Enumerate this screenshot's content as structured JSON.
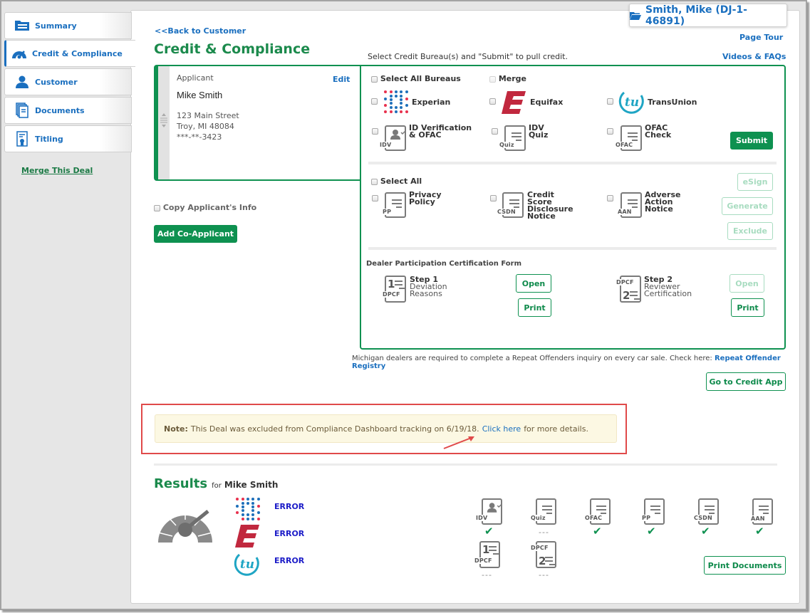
{
  "sidebar": {
    "items": [
      {
        "label": "Summary",
        "icon": "folder-list-icon",
        "active": false
      },
      {
        "label": "Credit & Compliance",
        "icon": "gauge-icon",
        "active": true
      },
      {
        "label": "Customer",
        "icon": "person-icon",
        "active": false
      },
      {
        "label": "Documents",
        "icon": "documents-icon",
        "active": false
      },
      {
        "label": "Titling",
        "icon": "certificate-icon",
        "active": false
      }
    ],
    "merge_link": "Merge This Deal"
  },
  "header": {
    "deal_badge": "Smith, Mike (DJ-1-46891)",
    "back_link": "<<Back to Customer",
    "title": "Credit & Compliance",
    "page_tour": "Page Tour",
    "videos_faqs": "Videos & FAQs",
    "instruction": "Select Credit Bureau(s) and \"Submit\" to pull credit."
  },
  "applicant": {
    "heading": "Applicant",
    "edit_label": "Edit",
    "name": "Mike Smith",
    "address1": "123 Main Street",
    "address2": "Troy, MI 48084",
    "ssn": "***-**-3423",
    "copy_label": "Copy Applicant's Info",
    "add_co_applicant": "Add Co-Applicant"
  },
  "bureaus": {
    "select_all": "Select All Bureaus",
    "merge": "Merge",
    "items": [
      {
        "label": "Experian",
        "icon": "experian-logo-icon"
      },
      {
        "label": "Equifax",
        "icon": "equifax-logo-icon"
      },
      {
        "label": "TransUnion",
        "icon": "transunion-logo-icon"
      }
    ],
    "checks": [
      {
        "line1": "ID Verification",
        "line2": "& OFAC",
        "tag": "IDV"
      },
      {
        "line1": "IDV",
        "line2": "Quiz",
        "tag": "Quiz"
      },
      {
        "line1": "OFAC",
        "line2": "Check",
        "tag": "OFAC"
      }
    ],
    "submit": "Submit"
  },
  "disclosures": {
    "select_all": "Select All",
    "items": [
      {
        "lines": [
          "Privacy",
          "Policy"
        ],
        "tag": "PP"
      },
      {
        "lines": [
          "Credit",
          "Score",
          "Disclosure",
          "Notice"
        ],
        "tag": "CSDN"
      },
      {
        "lines": [
          "Adverse",
          "Action",
          "Notice"
        ],
        "tag": "AAN"
      }
    ],
    "esign": "eSign",
    "generate": "Generate",
    "exclude": "Exclude"
  },
  "dpcf": {
    "heading": "Dealer Participation Certification Form",
    "step1": {
      "title": "Step 1",
      "line1": "Deviation",
      "line2": "Reasons",
      "tag": "DPCF",
      "num": "1",
      "open": "Open",
      "print": "Print"
    },
    "step2": {
      "title": "Step 2",
      "line1": "Reviewer",
      "line2": "Certification",
      "tag": "DPCF",
      "num": "2",
      "open": "Open",
      "print": "Print"
    }
  },
  "michigan_note": "Michigan dealers are required to complete a Repeat Offenders inquiry on every car sale. Check here:",
  "repeat_offender_link": "Repeat Offender Registry",
  "go_credit_app": "Go to Credit App",
  "note": {
    "label": "Note:",
    "text": "This Deal was excluded from Compliance Dashboard tracking on 6/19/18.",
    "link": "Click here",
    "suffix": "for more details."
  },
  "results": {
    "title": "Results",
    "for_label": "for",
    "name": "Mike Smith",
    "bureaus": [
      {
        "bureau": "Experian",
        "status": "ERROR"
      },
      {
        "bureau": "Equifax",
        "status": "ERROR"
      },
      {
        "bureau": "TransUnion",
        "status": "ERROR"
      }
    ],
    "docs": [
      {
        "tag": "IDV",
        "status": "check"
      },
      {
        "tag": "Quiz",
        "status": "---"
      },
      {
        "tag": "OFAC",
        "status": "check"
      },
      {
        "tag": "PP",
        "status": "check"
      },
      {
        "tag": "CSDN",
        "status": "check"
      },
      {
        "tag": "AAN",
        "status": "check"
      },
      {
        "tag": "DPCF",
        "num": "1",
        "status": "---"
      },
      {
        "tag": "DPCF",
        "num": "2",
        "status": "---"
      }
    ],
    "print_documents": "Print Documents"
  },
  "colors": {
    "brand_green": "#0e9150",
    "link_blue": "#1a6fbf",
    "error_blue": "#1c1cc8",
    "note_bg": "#fcf8e3",
    "highlight_red": "#e04a4a"
  }
}
